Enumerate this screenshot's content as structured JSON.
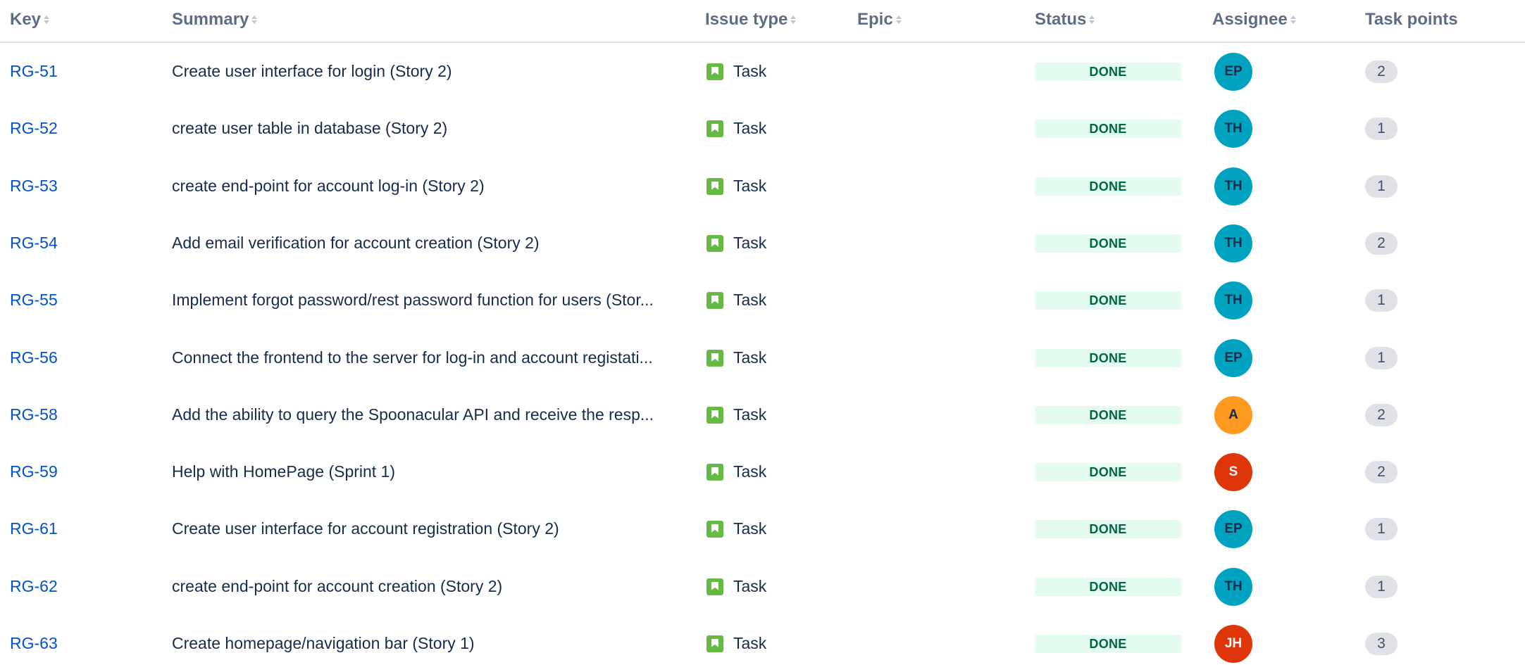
{
  "columns": {
    "key": "Key",
    "summary": "Summary",
    "issue_type": "Issue type",
    "epic": "Epic",
    "status": "Status",
    "assignee": "Assignee",
    "task_points": "Task points"
  },
  "colors": {
    "link": "#0052cc",
    "done_bg": "#e3fcef",
    "done_text": "#006644",
    "task_icon": "#65ba43"
  },
  "rows": [
    {
      "key": "RG-51",
      "summary": "Create user interface for login (Story 2)",
      "issue_type": "Task",
      "epic": "",
      "status": "DONE",
      "assignee": "EP",
      "assignee_color": "#00a3bf",
      "points": "2"
    },
    {
      "key": "RG-52",
      "summary": "create user table in database (Story 2)",
      "issue_type": "Task",
      "epic": "",
      "status": "DONE",
      "assignee": "TH",
      "assignee_color": "#00a3bf",
      "points": "1"
    },
    {
      "key": "RG-53",
      "summary": "create end-point for account log-in (Story 2)",
      "issue_type": "Task",
      "epic": "",
      "status": "DONE",
      "assignee": "TH",
      "assignee_color": "#00a3bf",
      "points": "1"
    },
    {
      "key": "RG-54",
      "summary": "Add email verification for account creation (Story 2)",
      "issue_type": "Task",
      "epic": "",
      "status": "DONE",
      "assignee": "TH",
      "assignee_color": "#00a3bf",
      "points": "2"
    },
    {
      "key": "RG-55",
      "summary": "Implement forgot password/rest password function for users (Stor...",
      "issue_type": "Task",
      "epic": "",
      "status": "DONE",
      "assignee": "TH",
      "assignee_color": "#00a3bf",
      "points": "1"
    },
    {
      "key": "RG-56",
      "summary": "Connect the frontend to the server for log-in and account registati...",
      "issue_type": "Task",
      "epic": "",
      "status": "DONE",
      "assignee": "EP",
      "assignee_color": "#00a3bf",
      "points": "1"
    },
    {
      "key": "RG-58",
      "summary": "Add the ability to query the Spoonacular API and receive the resp...",
      "issue_type": "Task",
      "epic": "",
      "status": "DONE",
      "assignee": "A",
      "assignee_color": "#ff991f",
      "points": "2"
    },
    {
      "key": "RG-59",
      "summary": "Help with HomePage (Sprint 1)",
      "issue_type": "Task",
      "epic": "",
      "status": "DONE",
      "assignee": "S",
      "assignee_color": "#de350b",
      "points": "2"
    },
    {
      "key": "RG-61",
      "summary": "Create user interface for account registration (Story 2)",
      "issue_type": "Task",
      "epic": "",
      "status": "DONE",
      "assignee": "EP",
      "assignee_color": "#00a3bf",
      "points": "1"
    },
    {
      "key": "RG-62",
      "summary": "create end-point for account creation (Story 2)",
      "issue_type": "Task",
      "epic": "",
      "status": "DONE",
      "assignee": "TH",
      "assignee_color": "#00a3bf",
      "points": "1"
    },
    {
      "key": "RG-63",
      "summary": "Create homepage/navigation bar (Story 1)",
      "issue_type": "Task",
      "epic": "",
      "status": "DONE",
      "assignee": "JH",
      "assignee_color": "#de350b",
      "points": "3"
    }
  ]
}
